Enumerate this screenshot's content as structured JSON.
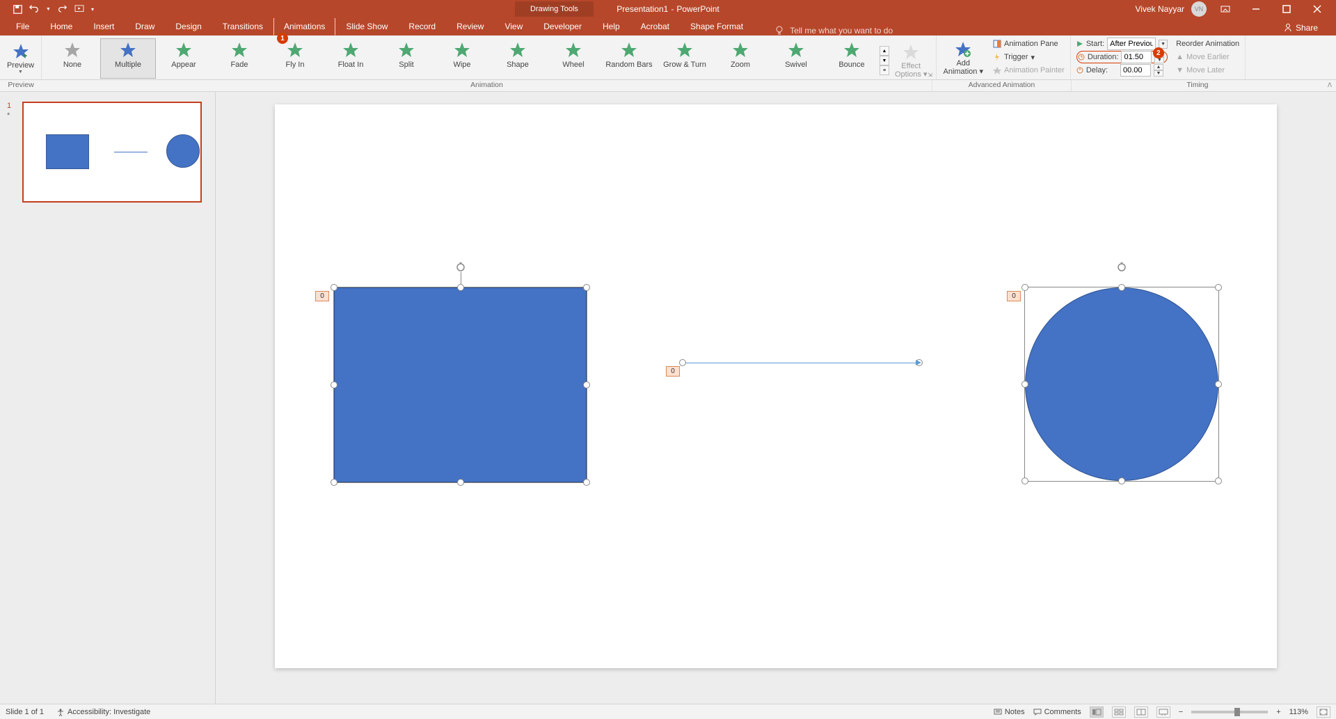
{
  "title": {
    "doc": "Presentation1",
    "sep": "-",
    "app": "PowerPoint",
    "contextTab": "Drawing Tools"
  },
  "user": {
    "name": "Vivek Nayyar",
    "initials": "VN"
  },
  "qat": {
    "save": "💾",
    "undo": "↶",
    "redo": "↷",
    "start": "⎙",
    "more": "▾"
  },
  "tabs": [
    "File",
    "Home",
    "Insert",
    "Draw",
    "Design",
    "Transitions",
    "Animations",
    "Slide Show",
    "Record",
    "Review",
    "View",
    "Developer",
    "Help",
    "Acrobat",
    "Shape Format"
  ],
  "activeTab": "Animations",
  "tellme": "Tell me what you want to do",
  "share": "Share",
  "ribbon": {
    "preview": {
      "label": "Preview",
      "group": "Preview"
    },
    "animGroup": "Animation",
    "animations": [
      {
        "name": "None",
        "color": "#a6a6a6"
      },
      {
        "name": "Multiple",
        "color": "#4472c4",
        "selected": true
      },
      {
        "name": "Appear",
        "color": "#4ea872"
      },
      {
        "name": "Fade",
        "color": "#4ea872"
      },
      {
        "name": "Fly In",
        "color": "#4ea872"
      },
      {
        "name": "Float In",
        "color": "#4ea872"
      },
      {
        "name": "Split",
        "color": "#4ea872"
      },
      {
        "name": "Wipe",
        "color": "#4ea872"
      },
      {
        "name": "Shape",
        "color": "#4ea872"
      },
      {
        "name": "Wheel",
        "color": "#4ea872"
      },
      {
        "name": "Random Bars",
        "color": "#4ea872"
      },
      {
        "name": "Grow & Turn",
        "color": "#4ea872"
      },
      {
        "name": "Zoom",
        "color": "#4ea872"
      },
      {
        "name": "Swivel",
        "color": "#4ea872"
      },
      {
        "name": "Bounce",
        "color": "#4ea872"
      }
    ],
    "effectOptions": {
      "label": "Effect",
      "label2": "Options"
    },
    "advGroup": "Advanced Animation",
    "addAnim": {
      "label": "Add",
      "label2": "Animation"
    },
    "animPane": "Animation Pane",
    "trigger": "Trigger",
    "animPainter": "Animation Painter",
    "timingGroup": "Timing",
    "start": {
      "label": "Start:",
      "value": "After Previous"
    },
    "duration": {
      "label": "Duration:",
      "value": "01.50"
    },
    "delay": {
      "label": "Delay:",
      "value": "00.00"
    },
    "reorder": "Reorder Animation",
    "moveEarlier": "Move Earlier",
    "moveLater": "Move Later"
  },
  "badges": {
    "flyIn": "1",
    "duration": "2"
  },
  "thumbs": {
    "number": "1",
    "asterisk": "*"
  },
  "shapes": {
    "rectTag": "0",
    "circTag": "0",
    "lineTag": "0"
  },
  "status": {
    "slide": "Slide 1 of 1",
    "access": "Accessibility: Investigate",
    "notes": "Notes",
    "comments": "Comments",
    "zoom": "113%"
  }
}
